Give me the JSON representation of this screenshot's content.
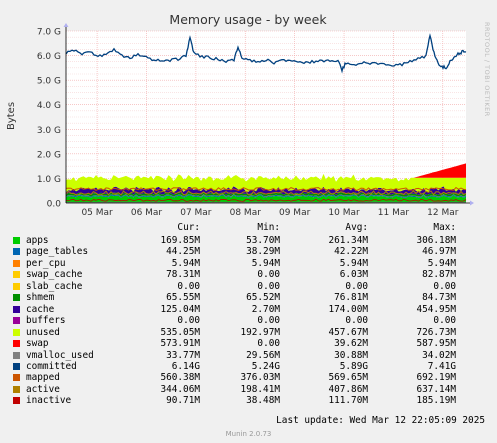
{
  "chart_data": {
    "type": "area",
    "title": "Memory usage - by week",
    "ylabel": "Bytes",
    "ylim": [
      0,
      7.0
    ],
    "y_unit": "G",
    "y_ticks": [
      "0.0",
      "1.0 G",
      "2.0 G",
      "3.0 G",
      "4.0 G",
      "5.0 G",
      "6.0 G",
      "7.0 G"
    ],
    "x_ticks": [
      "05 Mar",
      "06 Mar",
      "07 Mar",
      "08 Mar",
      "09 Mar",
      "10 Mar",
      "11 Mar",
      "12 Mar"
    ],
    "grid": true,
    "legend_headers": [
      "Cur:",
      "Min:",
      "Avg:",
      "Max:"
    ],
    "series": [
      {
        "name": "apps",
        "color": "#00cc00",
        "cur": "169.85M",
        "min": "53.70M",
        "avg": "261.34M",
        "max": "306.18M"
      },
      {
        "name": "page_tables",
        "color": "#0066b3",
        "cur": "44.25M",
        "min": "38.29M",
        "avg": "42.22M",
        "max": "46.97M"
      },
      {
        "name": "per_cpu",
        "color": "#ff8000",
        "cur": "5.94M",
        "min": "5.94M",
        "avg": "5.94M",
        "max": "5.94M"
      },
      {
        "name": "swap_cache",
        "color": "#ffcc00",
        "cur": "78.31M",
        "min": "0.00",
        "avg": "6.03M",
        "max": "82.87M"
      },
      {
        "name": "slab_cache",
        "color": "#ffcc00",
        "cur": "0.00",
        "min": "0.00",
        "avg": "0.00",
        "max": "0.00"
      },
      {
        "name": "shmem",
        "color": "#008f00",
        "cur": "65.55M",
        "min": "65.52M",
        "avg": "76.81M",
        "max": "84.73M"
      },
      {
        "name": "cache",
        "color": "#330099",
        "cur": "125.04M",
        "min": "2.70M",
        "avg": "174.00M",
        "max": "454.95M"
      },
      {
        "name": "buffers",
        "color": "#990099",
        "cur": "0.00",
        "min": "0.00",
        "avg": "0.00",
        "max": "0.00"
      },
      {
        "name": "unused",
        "color": "#ccff00",
        "cur": "535.05M",
        "min": "192.97M",
        "avg": "457.67M",
        "max": "726.73M"
      },
      {
        "name": "swap",
        "color": "#ff0000",
        "cur": "573.91M",
        "min": "0.00",
        "avg": "39.62M",
        "max": "587.95M"
      },
      {
        "name": "vmalloc_used",
        "color": "#808080",
        "cur": "33.77M",
        "min": "29.56M",
        "avg": "30.88M",
        "max": "34.02M"
      },
      {
        "name": "committed",
        "color": "#00407f",
        "cur": "6.14G",
        "min": "5.24G",
        "avg": "5.89G",
        "max": "7.41G"
      },
      {
        "name": "mapped",
        "color": "#cc5500",
        "cur": "560.38M",
        "min": "376.03M",
        "avg": "569.65M",
        "max": "692.19M"
      },
      {
        "name": "active",
        "color": "#b08000",
        "cur": "344.06M",
        "min": "198.41M",
        "avg": "407.86M",
        "max": "637.14M"
      },
      {
        "name": "inactive",
        "color": "#c00000",
        "cur": "90.71M",
        "min": "38.48M",
        "avg": "111.70M",
        "max": "185.19M"
      }
    ],
    "committed_line": [
      [
        0.0,
        6.08
      ],
      [
        0.02,
        6.22
      ],
      [
        0.04,
        6.02
      ],
      [
        0.06,
        6.18
      ],
      [
        0.08,
        5.95
      ],
      [
        0.1,
        6.05
      ],
      [
        0.12,
        6.28
      ],
      [
        0.14,
        6.0
      ],
      [
        0.16,
        5.9
      ],
      [
        0.18,
        6.05
      ],
      [
        0.2,
        5.95
      ],
      [
        0.22,
        5.8
      ],
      [
        0.24,
        5.78
      ],
      [
        0.26,
        5.82
      ],
      [
        0.28,
        5.85
      ],
      [
        0.3,
        6.0
      ],
      [
        0.31,
        6.75
      ],
      [
        0.32,
        6.1
      ],
      [
        0.34,
        5.95
      ],
      [
        0.36,
        5.92
      ],
      [
        0.38,
        5.85
      ],
      [
        0.4,
        5.78
      ],
      [
        0.42,
        5.82
      ],
      [
        0.43,
        6.35
      ],
      [
        0.44,
        5.9
      ],
      [
        0.46,
        5.8
      ],
      [
        0.48,
        5.75
      ],
      [
        0.5,
        5.82
      ],
      [
        0.52,
        5.72
      ],
      [
        0.54,
        5.78
      ],
      [
        0.56,
        5.8
      ],
      [
        0.58,
        5.75
      ],
      [
        0.6,
        5.72
      ],
      [
        0.62,
        5.75
      ],
      [
        0.64,
        5.78
      ],
      [
        0.66,
        5.76
      ],
      [
        0.68,
        5.8
      ],
      [
        0.69,
        5.4
      ],
      [
        0.7,
        5.72
      ],
      [
        0.72,
        5.6
      ],
      [
        0.74,
        5.72
      ],
      [
        0.76,
        5.7
      ],
      [
        0.78,
        5.65
      ],
      [
        0.8,
        5.62
      ],
      [
        0.82,
        5.6
      ],
      [
        0.84,
        5.65
      ],
      [
        0.86,
        5.75
      ],
      [
        0.88,
        5.85
      ],
      [
        0.9,
        6.0
      ],
      [
        0.91,
        6.8
      ],
      [
        0.92,
        6.1
      ],
      [
        0.93,
        5.7
      ],
      [
        0.94,
        5.55
      ],
      [
        0.95,
        5.5
      ],
      [
        0.96,
        5.75
      ],
      [
        0.97,
        5.9
      ],
      [
        0.98,
        6.05
      ],
      [
        0.99,
        6.15
      ],
      [
        1.0,
        6.14
      ]
    ]
  },
  "last_update": "Last update: Wed Mar 12 22:05:09 2025",
  "munin_version": "Munin 2.0.73",
  "side_label": "RRDTOOL / TOBI OETIKER"
}
